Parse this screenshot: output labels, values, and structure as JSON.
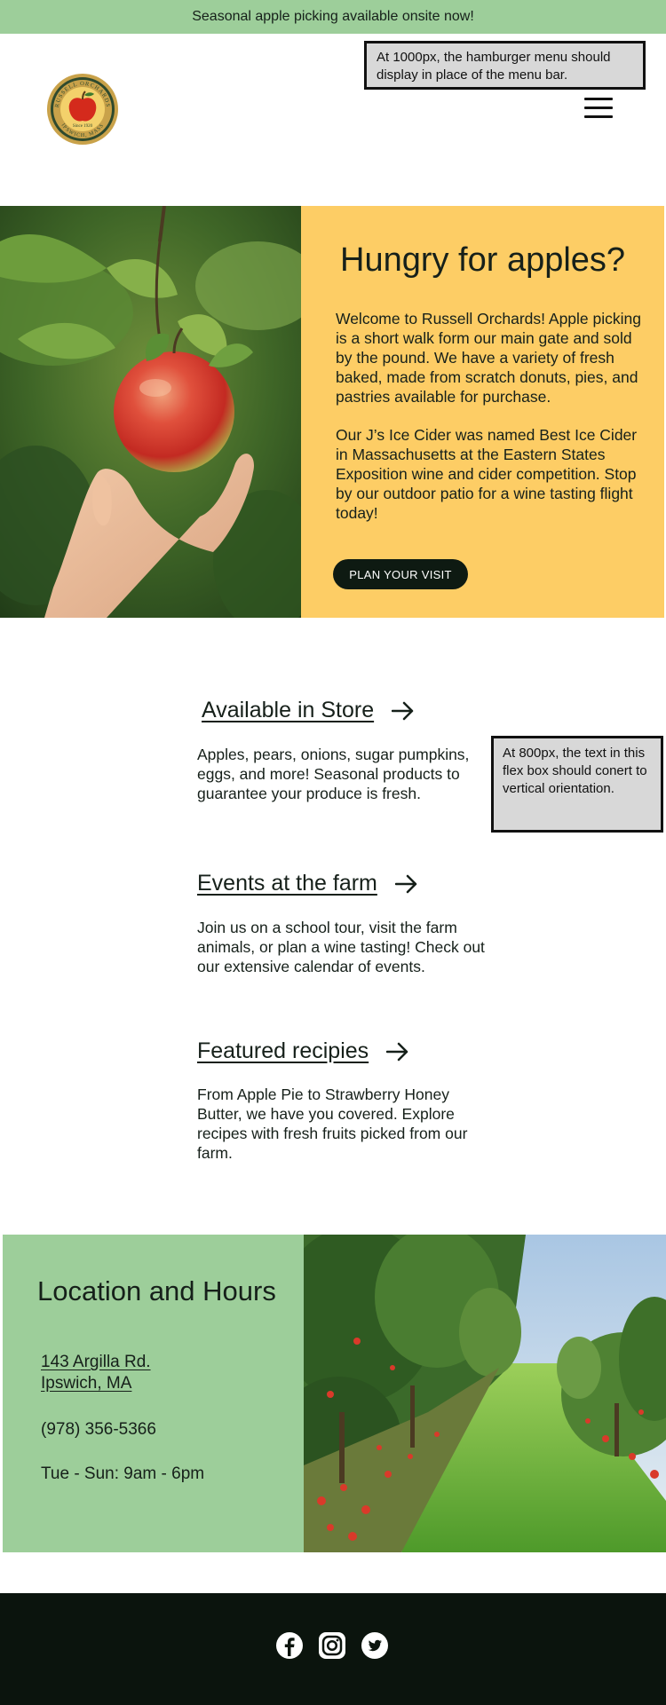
{
  "announcement": "Seasonal apple picking available onsite now!",
  "logo": {
    "name": "Russell Orchards",
    "icon": "orchard-seal-logo-icon",
    "seal_top": "RUSSELL ORCHARDS",
    "seal_center": "Since 1920",
    "seal_bottom": "IPSWICH, MASS"
  },
  "notes": {
    "hamburger": "At 1000px, the hamburger menu should display in place of the menu bar.",
    "flex": "At 800px, the text in this flex box should conert to vertical orientation."
  },
  "hero": {
    "image_alt": "Hand picking a ripe red apple from a tree",
    "title": "Hungry for apples?",
    "paragraph1": "Welcome to Russell Orchards! Apple picking is a short walk form our main gate and sold by the pound. We have a variety of fresh baked, made from scratch donuts, pies, and pastries available for purchase.",
    "paragraph2": "Our J’s Ice Cider was named Best Ice Cider in Massachusetts at the Eastern States Exposition wine and cider competition. Stop by our outdoor patio for a wine tasting flight today!",
    "cta_label": "PLAN YOUR VISIT"
  },
  "features": [
    {
      "title": "Available in Store",
      "text": "Apples, pears, onions, sugar pumpkins, eggs, and more! Seasonal products to guarantee your produce is fresh.",
      "icon": "arrow-right-icon"
    },
    {
      "title": "Events at the farm",
      "text": "Join us on a school tour, visit the farm animals, or plan a wine tasting! Check out our extensive calendar of events.",
      "icon": "arrow-right-icon"
    },
    {
      "title": "Featured recipies",
      "text": "From Apple Pie to Strawberry Honey Butter, we have you covered. Explore recipes with fresh fruits picked from our farm.",
      "icon": "arrow-right-icon"
    }
  ],
  "location": {
    "title": "Location and Hours",
    "address_line1": "143 Argilla Rd.",
    "address_line2": "Ipswich, MA",
    "phone": "(978) 356-5366",
    "hours": "Tue - Sun: 9am - 6pm",
    "image_alt": "Rows of apple trees with fallen apples on green grass"
  },
  "footer": {
    "social": [
      "facebook-icon",
      "instagram-icon",
      "twitter-icon"
    ]
  },
  "colors": {
    "banner_green": "#9dce9a",
    "hero_yellow": "#fdcd65",
    "dark": "#0b140d",
    "text": "#16201a"
  }
}
